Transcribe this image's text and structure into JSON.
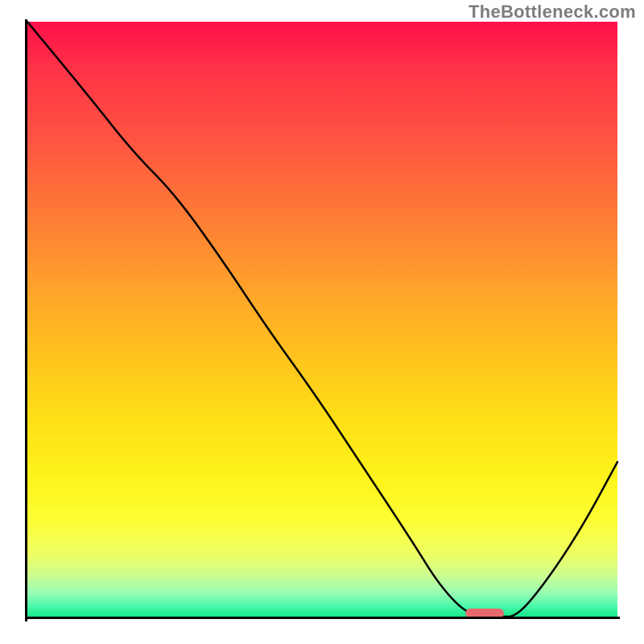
{
  "attribution": "TheBottleneck.com",
  "chart_data": {
    "type": "line",
    "title": "",
    "xlabel": "",
    "ylabel": "",
    "x_range": [
      0,
      100
    ],
    "y_range": [
      0,
      100
    ],
    "curve": {
      "x": [
        0,
        10,
        18,
        25,
        33,
        41,
        49,
        57,
        65,
        70,
        75,
        80,
        83,
        88,
        94,
        100
      ],
      "y": [
        100,
        88,
        78,
        71,
        60,
        48,
        37,
        25,
        13,
        5,
        0,
        0,
        0,
        6,
        15,
        26
      ]
    },
    "marker": {
      "x_center": 77.5,
      "width": 6.5,
      "y": 0
    },
    "gradient_stops": [
      {
        "pos": 0.0,
        "color": "#ff0e4a"
      },
      {
        "pos": 0.08,
        "color": "#ff3347"
      },
      {
        "pos": 0.21,
        "color": "#ff5741"
      },
      {
        "pos": 0.34,
        "color": "#fe8034"
      },
      {
        "pos": 0.46,
        "color": "#ffa629"
      },
      {
        "pos": 0.57,
        "color": "#ffc51d"
      },
      {
        "pos": 0.67,
        "color": "#fde016"
      },
      {
        "pos": 0.77,
        "color": "#fff41b"
      },
      {
        "pos": 0.84,
        "color": "#fcfe35"
      },
      {
        "pos": 0.895,
        "color": "#eefe63"
      },
      {
        "pos": 0.93,
        "color": "#cdfd90"
      },
      {
        "pos": 0.96,
        "color": "#99fcb2"
      },
      {
        "pos": 0.982,
        "color": "#4cf8ab"
      },
      {
        "pos": 1.0,
        "color": "#16e88a"
      }
    ]
  }
}
